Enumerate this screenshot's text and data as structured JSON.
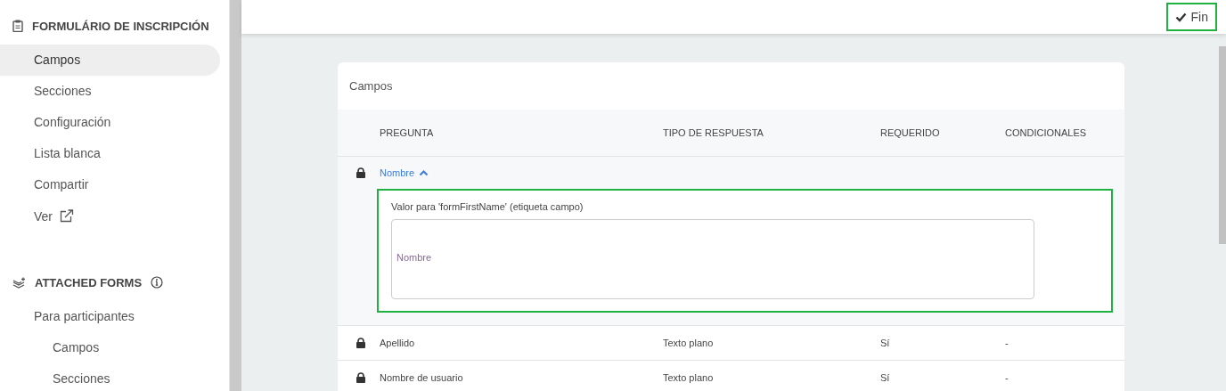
{
  "sidebar": {
    "sections": [
      {
        "kind": "form",
        "title": "FORMULÁRIO DE INSCRIPCIÓN",
        "items": [
          {
            "label": "Campos",
            "selected": true
          },
          {
            "label": "Secciones",
            "selected": false
          },
          {
            "label": "Configuración",
            "selected": false
          },
          {
            "label": "Lista blanca",
            "selected": false
          },
          {
            "label": "Compartir",
            "selected": false
          },
          {
            "label": "Ver",
            "selected": false,
            "external": true
          }
        ]
      },
      {
        "kind": "attached",
        "title": "ATTACHED FORMS",
        "info": true,
        "items": [
          {
            "label": "Para participantes",
            "selected": false,
            "children": [
              {
                "label": "Campos",
                "selected": false
              },
              {
                "label": "Secciones",
                "selected": false
              }
            ]
          }
        ]
      }
    ]
  },
  "topbar": {
    "done_button": "Fin"
  },
  "card": {
    "title": "Campos",
    "columns": [
      "PREGUNTA",
      "TIPO DE RESPUESTA",
      "REQUERIDO",
      "CONDICIONALES"
    ],
    "rows": [
      {
        "question": "Nombre",
        "locked": true,
        "expanded": true,
        "editor": {
          "label": "Valor para 'formFirstName' (etiqueta campo)",
          "placeholder": "Nombre"
        }
      },
      {
        "question": "Apellido",
        "locked": true,
        "expanded": false,
        "type": "Texto plano",
        "required": "Sí",
        "conditionals": "-"
      },
      {
        "question": "Nombre de usuario",
        "locked": true,
        "expanded": false,
        "type": "Texto plano",
        "required": "Sí",
        "conditionals": "-"
      }
    ]
  }
}
